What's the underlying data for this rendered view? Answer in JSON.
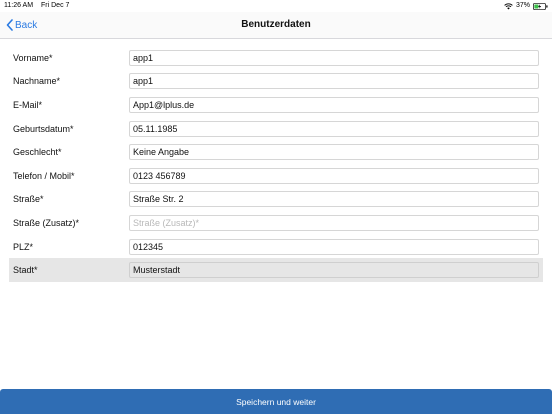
{
  "status_bar": {
    "time": "11:26 AM",
    "date": "Fri Dec 7",
    "battery": "37%",
    "icons": [
      "wifi-icon",
      "battery-charging-icon"
    ]
  },
  "nav": {
    "back_label": "Back",
    "title": "Benutzerdaten",
    "accent_color": "#2a7ae2"
  },
  "form": {
    "fields": [
      {
        "label": "Vorname*",
        "value": "app1",
        "placeholder": ""
      },
      {
        "label": "Nachname*",
        "value": "app1",
        "placeholder": ""
      },
      {
        "label": "E-Mail*",
        "value": "App1@lplus.de",
        "placeholder": ""
      },
      {
        "label": "Geburtsdatum*",
        "value": "05.11.1985",
        "placeholder": ""
      },
      {
        "label": "Geschlecht*",
        "value": "Keine Angabe",
        "placeholder": ""
      },
      {
        "label": "Telefon / Mobil*",
        "value": "0123 456789",
        "placeholder": ""
      },
      {
        "label": "Straße*",
        "value": "Straße Str. 2",
        "placeholder": ""
      },
      {
        "label": "Straße (Zusatz)*",
        "value": "",
        "placeholder": "Straße (Zusatz)*"
      },
      {
        "label": "PLZ*",
        "value": "012345",
        "placeholder": ""
      },
      {
        "label": "Stadt*",
        "value": "Musterstadt",
        "placeholder": "",
        "highlighted": true
      }
    ]
  },
  "footer": {
    "save_label": "Speichern und weiter",
    "button_color": "#2f6db4"
  }
}
